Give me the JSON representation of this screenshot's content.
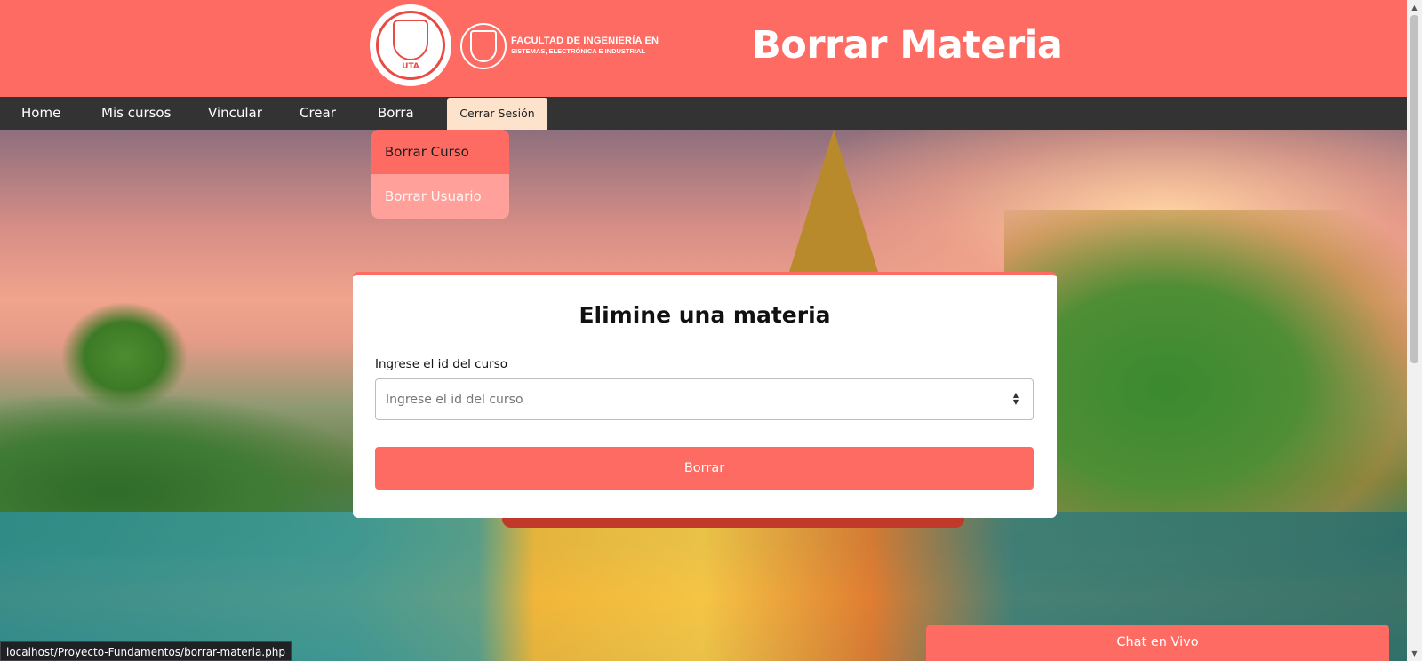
{
  "header": {
    "seal_text": "UTA",
    "faculty_line1": "FACULTAD DE INGENIERÍA EN",
    "faculty_line2": "SISTEMAS, ELECTRÓNICA E INDUSTRIAL",
    "title": "Borrar Materia"
  },
  "nav": {
    "items": [
      {
        "label": "Home"
      },
      {
        "label": "Mis cursos"
      },
      {
        "label": "Vincular"
      },
      {
        "label": "Crear"
      },
      {
        "label": "Borra"
      }
    ],
    "logout_label": "Cerrar Sesión"
  },
  "dropdown": {
    "items": [
      {
        "label": "Borrar Curso",
        "active": true
      },
      {
        "label": "Borrar Usuario",
        "active": false
      }
    ]
  },
  "form": {
    "heading": "Elimine una materia",
    "field_label": "Ingrese el id del curso",
    "field_placeholder": "Ingrese el id del curso",
    "field_value": "",
    "submit_label": "Borrar"
  },
  "chat": {
    "label": "Chat en Vivo"
  },
  "status_bar": {
    "url": "localhost/Proyecto-Fundamentos/borrar-materia.php"
  },
  "colors": {
    "accent": "#fe6b63",
    "nav_bg": "#333333",
    "logout_bg": "#fde3cc",
    "dropdown_secondary": "#ffa19a"
  },
  "icons": {
    "spinner": "number-spinner-icon",
    "scroll_up": "scroll-up-arrow-icon",
    "scroll_down": "scroll-down-arrow-icon"
  }
}
